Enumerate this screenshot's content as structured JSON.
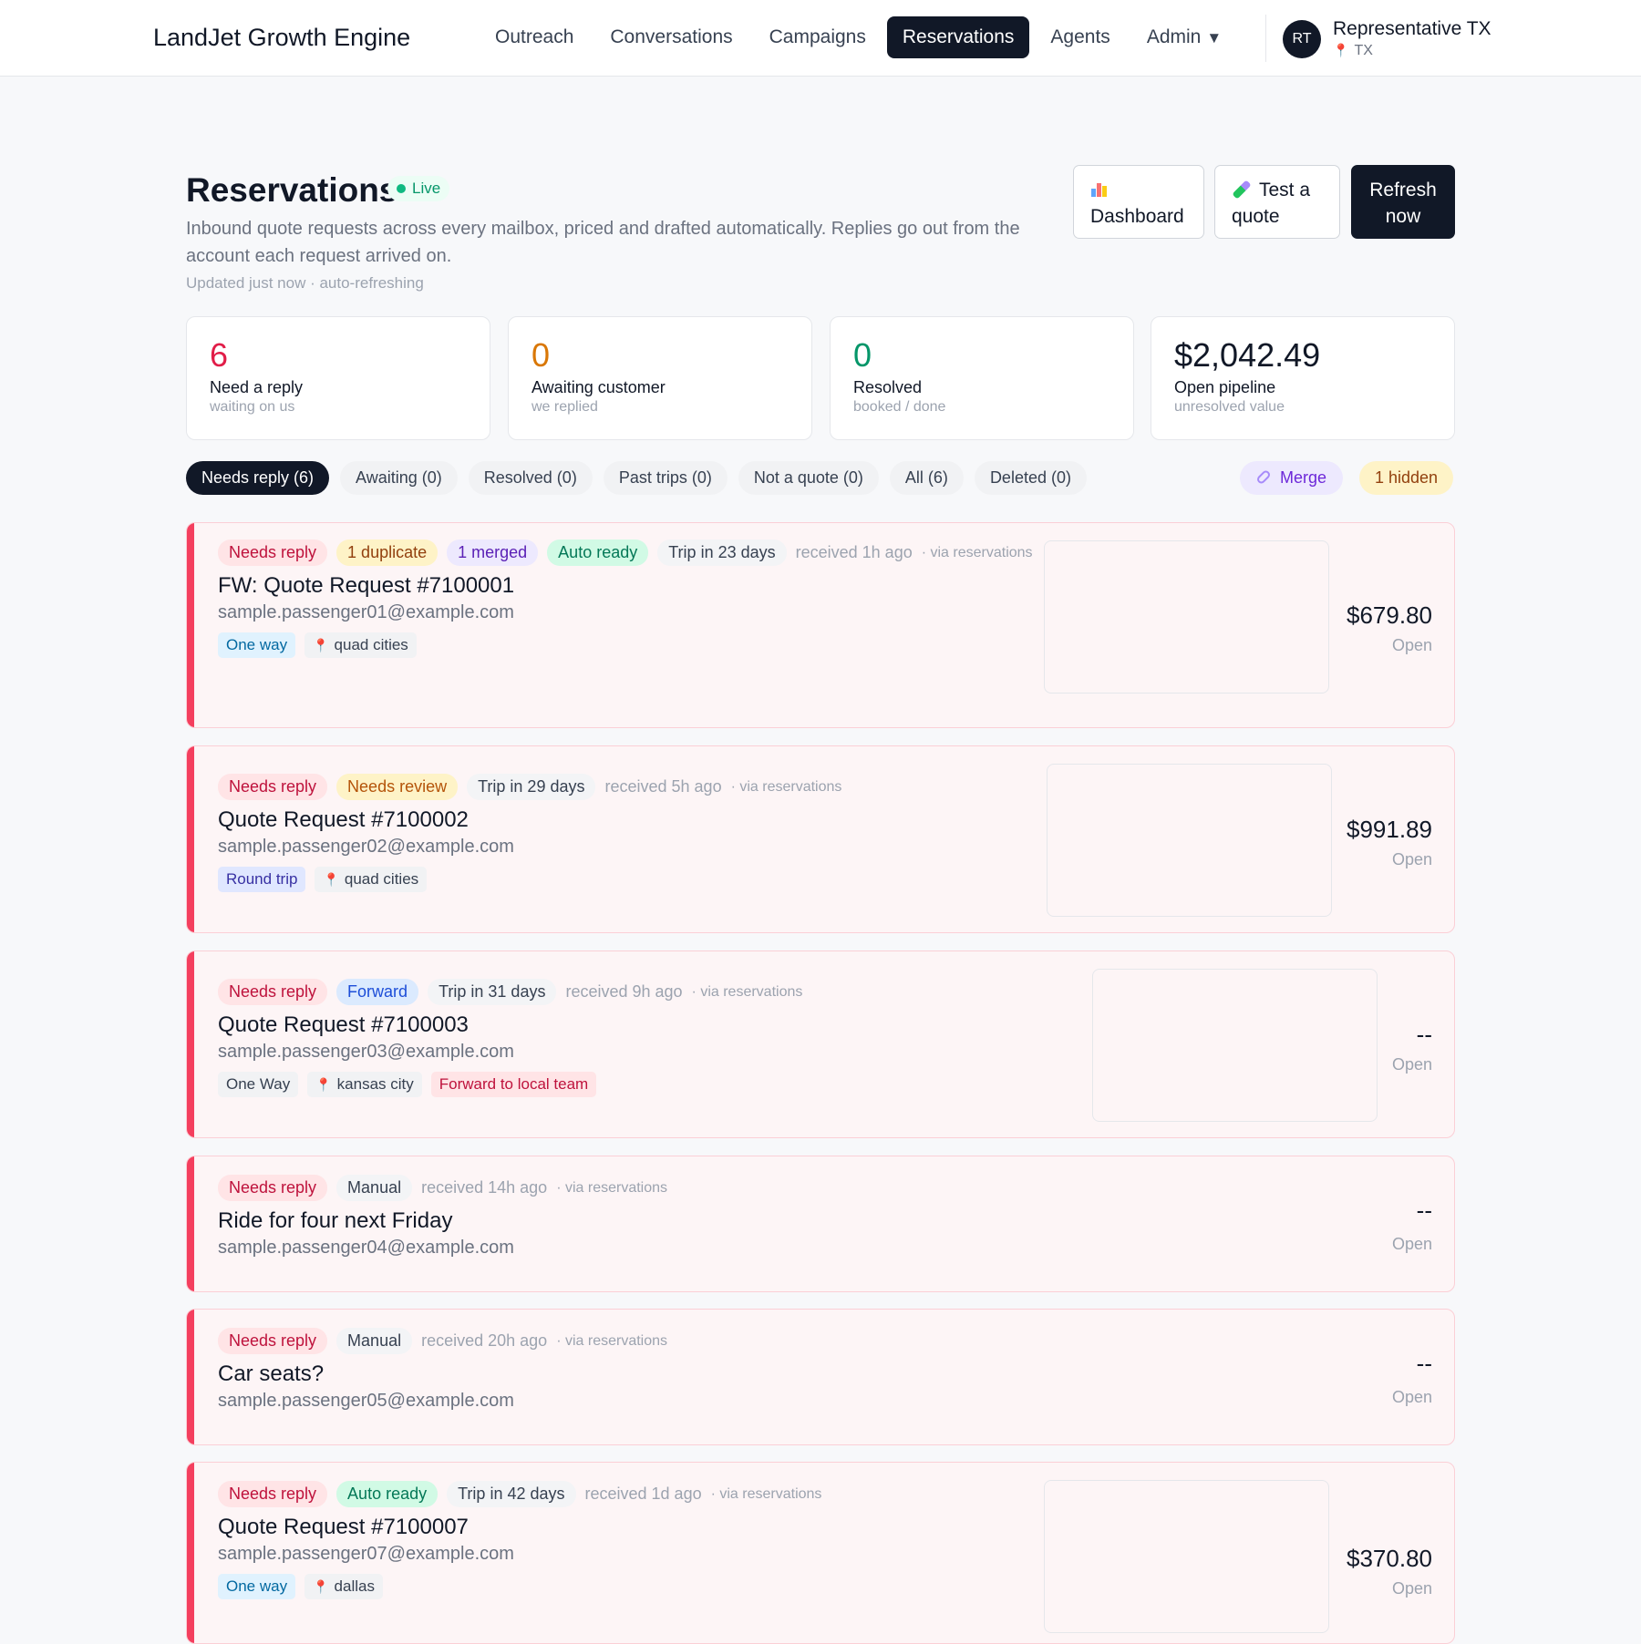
{
  "app": {
    "brand": "LandJet Growth Engine"
  },
  "nav": {
    "items": [
      "Outreach",
      "Conversations",
      "Campaigns",
      "Reservations",
      "Agents",
      "Admin"
    ],
    "active": "Reservations",
    "admin_caret": "▼"
  },
  "user": {
    "initials": "RT",
    "name": "Representative TX",
    "location": "TX"
  },
  "header": {
    "title": "Reservations",
    "live_label": "Live",
    "subtitle": "Inbound quote requests across every mailbox, priced and drafted automatically. Replies go out from the account each request arrived on.",
    "updated": "Updated just now · auto-refreshing",
    "buttons": {
      "dashboard": "Dashboard",
      "test_quote": "Test a quote",
      "refresh": "Refresh now"
    }
  },
  "stats": [
    {
      "value": "6",
      "label": "Need a reply",
      "sub": "waiting on us",
      "color": "#e11d48"
    },
    {
      "value": "0",
      "label": "Awaiting customer",
      "sub": "we replied",
      "color": "#d97706"
    },
    {
      "value": "0",
      "label": "Resolved",
      "sub": "booked / done",
      "color": "#059669"
    },
    {
      "value": "$2,042.49",
      "label": "Open pipeline",
      "sub": "unresolved value",
      "color": "#111827"
    }
  ],
  "tabs": [
    "Needs reply (6)",
    "Awaiting (0)",
    "Resolved (0)",
    "Past trips (0)",
    "Not a quote (0)",
    "All (6)",
    "Deleted (0)"
  ],
  "actions": {
    "merge": "Merge",
    "hidden": "1 hidden"
  },
  "cards": [
    {
      "badges": [
        "Needs reply",
        "1 duplicate",
        "1 merged",
        "Auto ready",
        "Trip in 23 days"
      ],
      "received": "received 1h ago",
      "via": "· via reservations",
      "title": "FW: Quote Request #7100001",
      "email": "sample.passenger01@example.com",
      "tags": [
        "One way",
        "quad cities"
      ],
      "price": "$679.80",
      "status": "Open"
    },
    {
      "badges": [
        "Needs reply",
        "Needs review",
        "Trip in 29 days"
      ],
      "received": "received 5h ago",
      "via": "· via reservations",
      "title": "Quote Request #7100002",
      "email": "sample.passenger02@example.com",
      "tags": [
        "Round trip",
        "quad cities"
      ],
      "price": "$991.89",
      "status": "Open"
    },
    {
      "badges": [
        "Needs reply",
        "Forward",
        "Trip in 31 days"
      ],
      "received": "received 9h ago",
      "via": "· via reservations",
      "title": "Quote Request #7100003",
      "email": "sample.passenger03@example.com",
      "tags": [
        "One Way",
        "kansas city",
        "Forward to local team"
      ],
      "price": "--",
      "status": "Open"
    },
    {
      "badges": [
        "Needs reply",
        "Manual"
      ],
      "received": "received 14h ago",
      "via": "· via reservations",
      "title": "Ride for four next Friday",
      "email": "sample.passenger04@example.com",
      "tags": [],
      "price": "--",
      "status": "Open"
    },
    {
      "badges": [
        "Needs reply",
        "Manual"
      ],
      "received": "received 20h ago",
      "via": "· via reservations",
      "title": "Car seats?",
      "email": "sample.passenger05@example.com",
      "tags": [],
      "price": "--",
      "status": "Open"
    },
    {
      "badges": [
        "Needs reply",
        "Auto ready",
        "Trip in 42 days"
      ],
      "received": "received 1d ago",
      "via": "· via reservations",
      "title": "Quote Request #7100007",
      "email": "sample.passenger07@example.com",
      "tags": [
        "One way",
        "dallas"
      ],
      "price": "$370.80",
      "status": "Open"
    }
  ]
}
